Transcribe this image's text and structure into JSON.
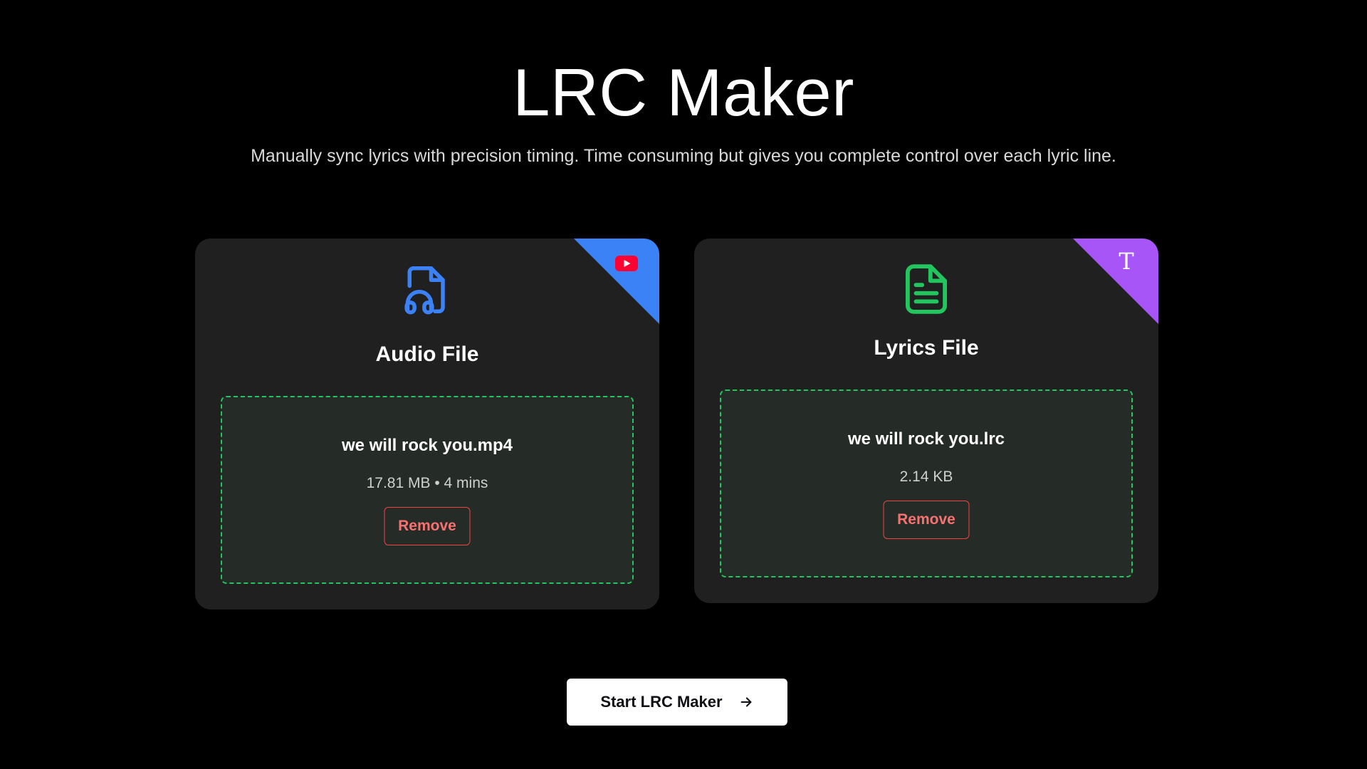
{
  "header": {
    "title": "LRC Maker",
    "subtitle": "Manually sync lyrics with precision timing. Time consuming but gives you complete control over each lyric line."
  },
  "audio_card": {
    "title": "Audio File",
    "corner_icon": "youtube-icon",
    "corner_color": "#3b82f6",
    "icon": "file-music-icon",
    "icon_color": "#3b82f6",
    "file_name": "we will rock you.mp4",
    "file_meta": "17.81 MB • 4 mins",
    "remove_label": "Remove"
  },
  "lyrics_card": {
    "title": "Lyrics File",
    "corner_icon": "text-icon",
    "corner_glyph": "T",
    "corner_color": "#a855f7",
    "icon": "file-text-icon",
    "icon_color": "#22c55e",
    "file_name": "we will rock you.lrc",
    "file_meta": "2.14 KB",
    "remove_label": "Remove"
  },
  "start_button": {
    "label": "Start LRC Maker",
    "icon": "arrow-right-icon"
  },
  "colors": {
    "background": "#000000",
    "card": "#202020",
    "dropzone_border": "#22c55e",
    "remove": "#ef4444"
  }
}
